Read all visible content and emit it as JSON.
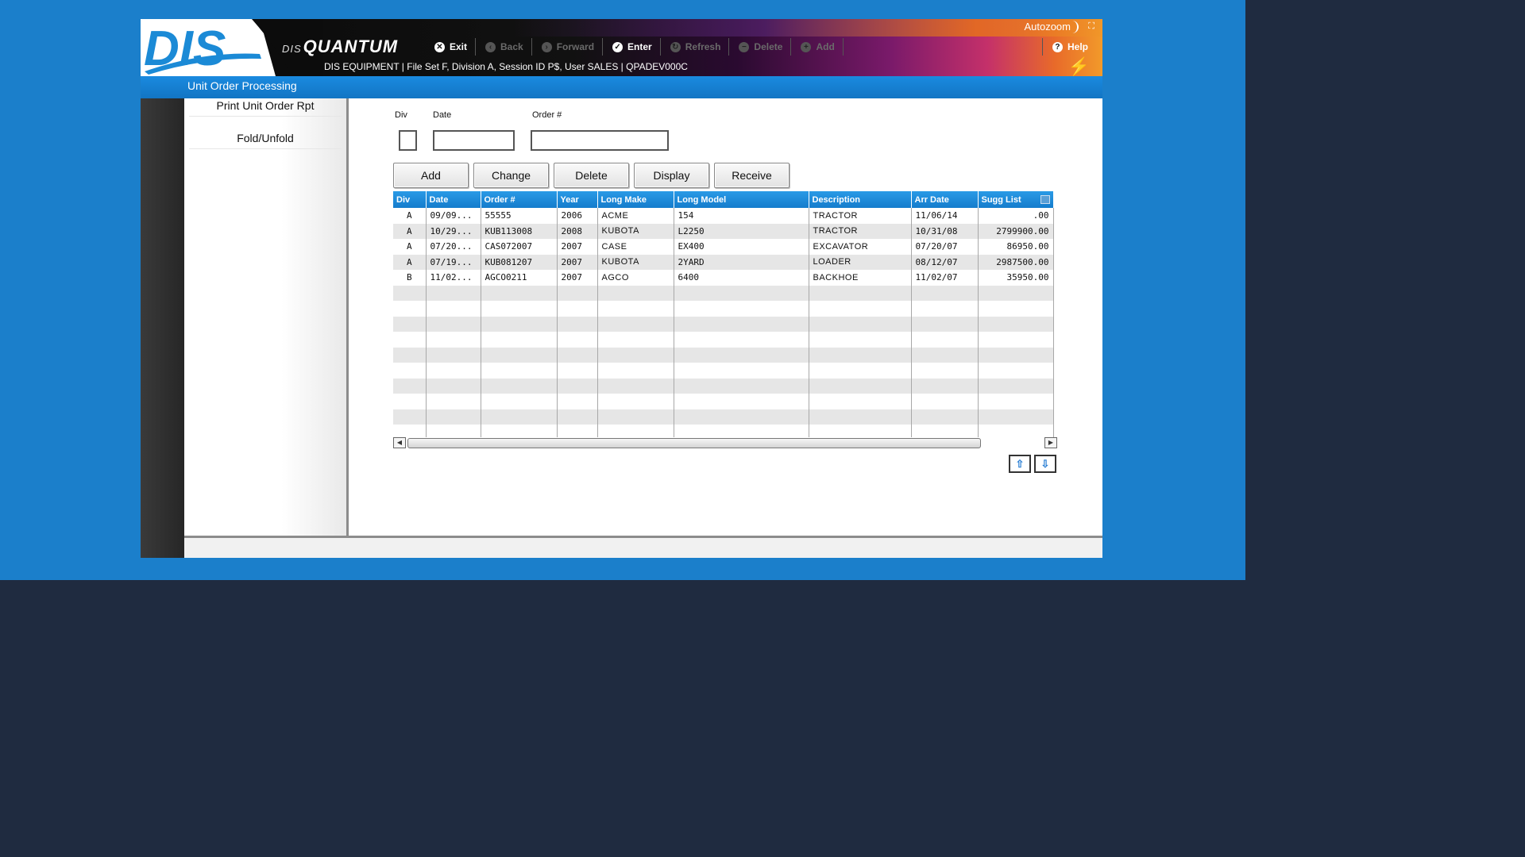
{
  "header": {
    "logo_text": "DIS",
    "brand_prefix": "DIS",
    "brand_name": "QUANTUM",
    "autozoom_label": "Autozoom",
    "status_line": "DIS EQUIPMENT | File Set F, Division A, Session ID P$, User SALES | QPADEV000C",
    "help_label": "Help"
  },
  "toolbar": {
    "exit": "Exit",
    "back": "Back",
    "forward": "Forward",
    "enter": "Enter",
    "refresh": "Refresh",
    "delete": "Delete",
    "add": "Add"
  },
  "page": {
    "title": "Unit Order Processing"
  },
  "sidebar": {
    "items": [
      {
        "label": "Print Unit Order Rpt"
      },
      {
        "label": "Fold/Unfold"
      }
    ]
  },
  "form": {
    "div_label": "Div",
    "date_label": "Date",
    "order_label": "Order #",
    "div_value": "",
    "date_value": "",
    "order_value": ""
  },
  "actions": {
    "add": "Add",
    "change": "Change",
    "delete": "Delete",
    "display": "Display",
    "receive": "Receive"
  },
  "grid": {
    "columns": [
      "Div",
      "Date",
      "Order #",
      "Year",
      "Long Make",
      "Long Model",
      "Description",
      "Arr Date",
      "Sugg List"
    ],
    "rows": [
      [
        "A",
        "09/09...",
        "55555",
        "2006",
        "ACME",
        "154",
        "TRACTOR",
        "11/06/14",
        ".00"
      ],
      [
        "A",
        "10/29...",
        "KUB113008",
        "2008",
        "KUBOTA",
        "L2250",
        "TRACTOR",
        "10/31/08",
        "2799900.00"
      ],
      [
        "A",
        "07/20...",
        "CAS072007",
        "2007",
        "CASE",
        "EX400",
        "EXCAVATOR",
        "07/20/07",
        "86950.00"
      ],
      [
        "A",
        "07/19...",
        "KUB081207",
        "2007",
        "KUBOTA",
        "2YARD",
        "LOADER",
        "08/12/07",
        "2987500.00"
      ],
      [
        "B",
        "11/02...",
        "AGCO0211",
        "2007",
        "AGCO",
        "6400",
        "BACKHOE",
        "11/02/07",
        "35950.00"
      ]
    ]
  }
}
